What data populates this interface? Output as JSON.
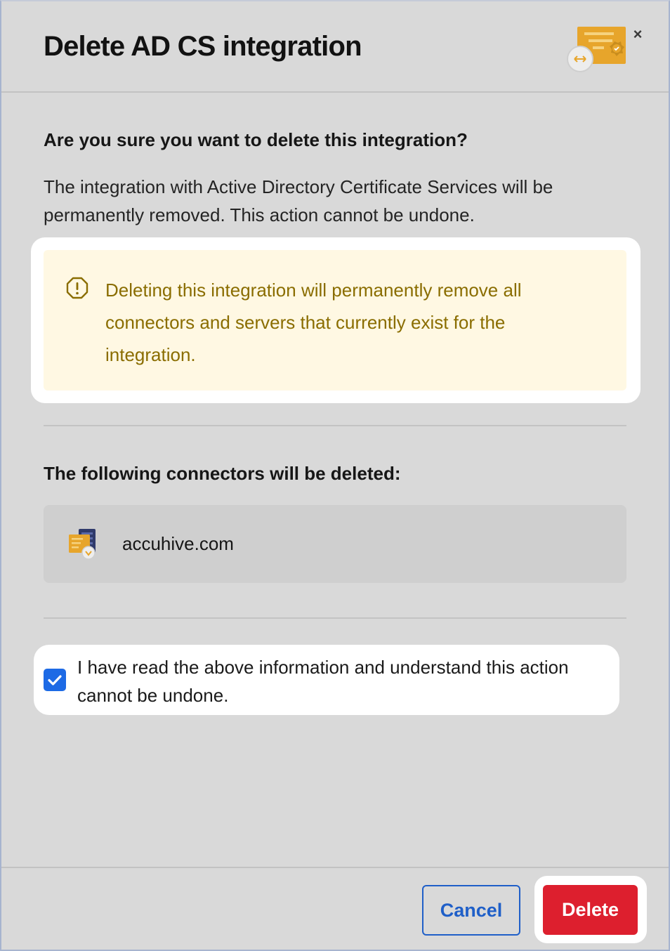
{
  "modal": {
    "title": "Delete AD CS integration",
    "close_glyph": "×"
  },
  "confirm": {
    "question": "Are you sure you want to delete this integration?",
    "description": "The integration with Active Directory Certificate Services will be permanently removed. This action cannot be undone."
  },
  "warning": {
    "text": "Deleting this integration will permanently remove all connectors and servers that currently exist for the integration.",
    "icon": "alert-circle-icon"
  },
  "connectors": {
    "heading": "The following connectors will be deleted:",
    "items": [
      {
        "name": "accuhive.com",
        "icon": "certificate-server-icon"
      }
    ]
  },
  "acknowledgement": {
    "label": "I have read the above information and understand this action cannot be undone.",
    "checked": true
  },
  "footer": {
    "cancel_label": "Cancel",
    "delete_label": "Delete"
  },
  "colors": {
    "primary_blue": "#1d6ae5",
    "danger_red": "#dd1f2e",
    "warning_bg": "#fff8e3",
    "warning_text": "#8a6d00",
    "certificate_gold": "#e7a52b"
  }
}
